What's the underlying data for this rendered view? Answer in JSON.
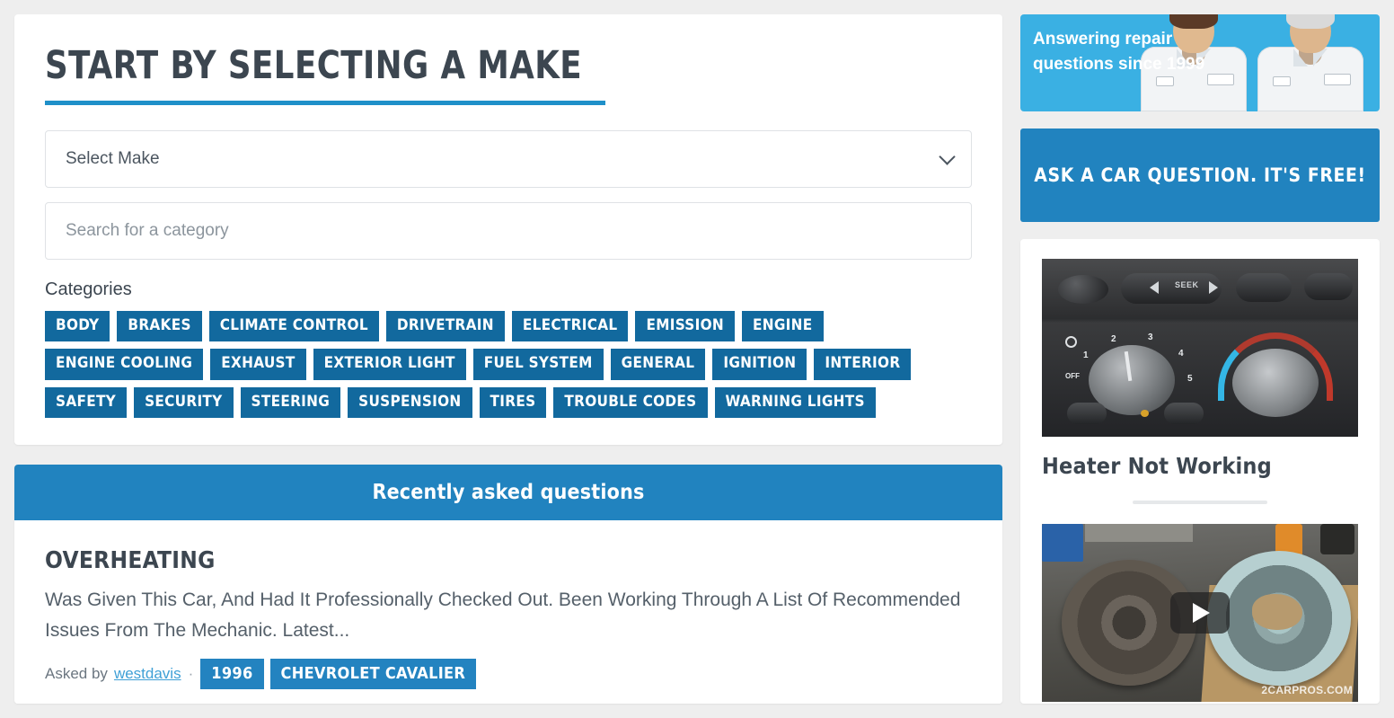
{
  "main": {
    "heading": "Start by selecting a make",
    "select_make": {
      "value": "Select Make",
      "icon": "chevron-down-icon"
    },
    "category_search": {
      "placeholder": "Search for a category",
      "value": ""
    },
    "categories_label": "Categories",
    "categories": [
      "BODY",
      "BRAKES",
      "CLIMATE CONTROL",
      "DRIVETRAIN",
      "ELECTRICAL",
      "EMISSION",
      "ENGINE",
      "ENGINE COOLING",
      "EXHAUST",
      "EXTERIOR LIGHT",
      "FUEL SYSTEM",
      "GENERAL",
      "IGNITION",
      "INTERIOR",
      "SAFETY",
      "SECURITY",
      "STEERING",
      "SUSPENSION",
      "TIRES",
      "TROUBLE CODES",
      "WARNING LIGHTS"
    ]
  },
  "questions": {
    "header": "Recently asked questions",
    "items": [
      {
        "title": "OVERHEATING",
        "excerpt": "Was Given This Car, And Had It Professionally Checked Out. Been Working Through A List Of Recommended Issues From The Mechanic. Latest...",
        "asked_by_label": "Asked by",
        "author": "westdavis",
        "separator": "·",
        "year": "1996",
        "vehicle": "CHEVROLET CAVALIER"
      }
    ]
  },
  "sidebar": {
    "promo": {
      "text": "Answering repair questions since 1999",
      "image": "two-mechanics-photo"
    },
    "cta": {
      "label": "Ask a car question. It's free!"
    },
    "videos": [
      {
        "thumb": "hvac-control-panel-photo",
        "title": "Heater Not Working",
        "has_play_button": false
      },
      {
        "thumb": "brake-rotors-photo",
        "title": "",
        "has_play_button": true,
        "watermark": "2CARPROS.COM"
      }
    ]
  },
  "colors": {
    "page_background": "#eeeeee",
    "card_background": "#ffffff",
    "brand_blue": "#2183bf",
    "tag_blue": "#12699e",
    "rule_blue": "#1f90c9",
    "promo_blue": "#3ab0e3",
    "heading_text": "#3c4650",
    "body_text": "#55606a",
    "link_blue": "#3fa0d6"
  }
}
